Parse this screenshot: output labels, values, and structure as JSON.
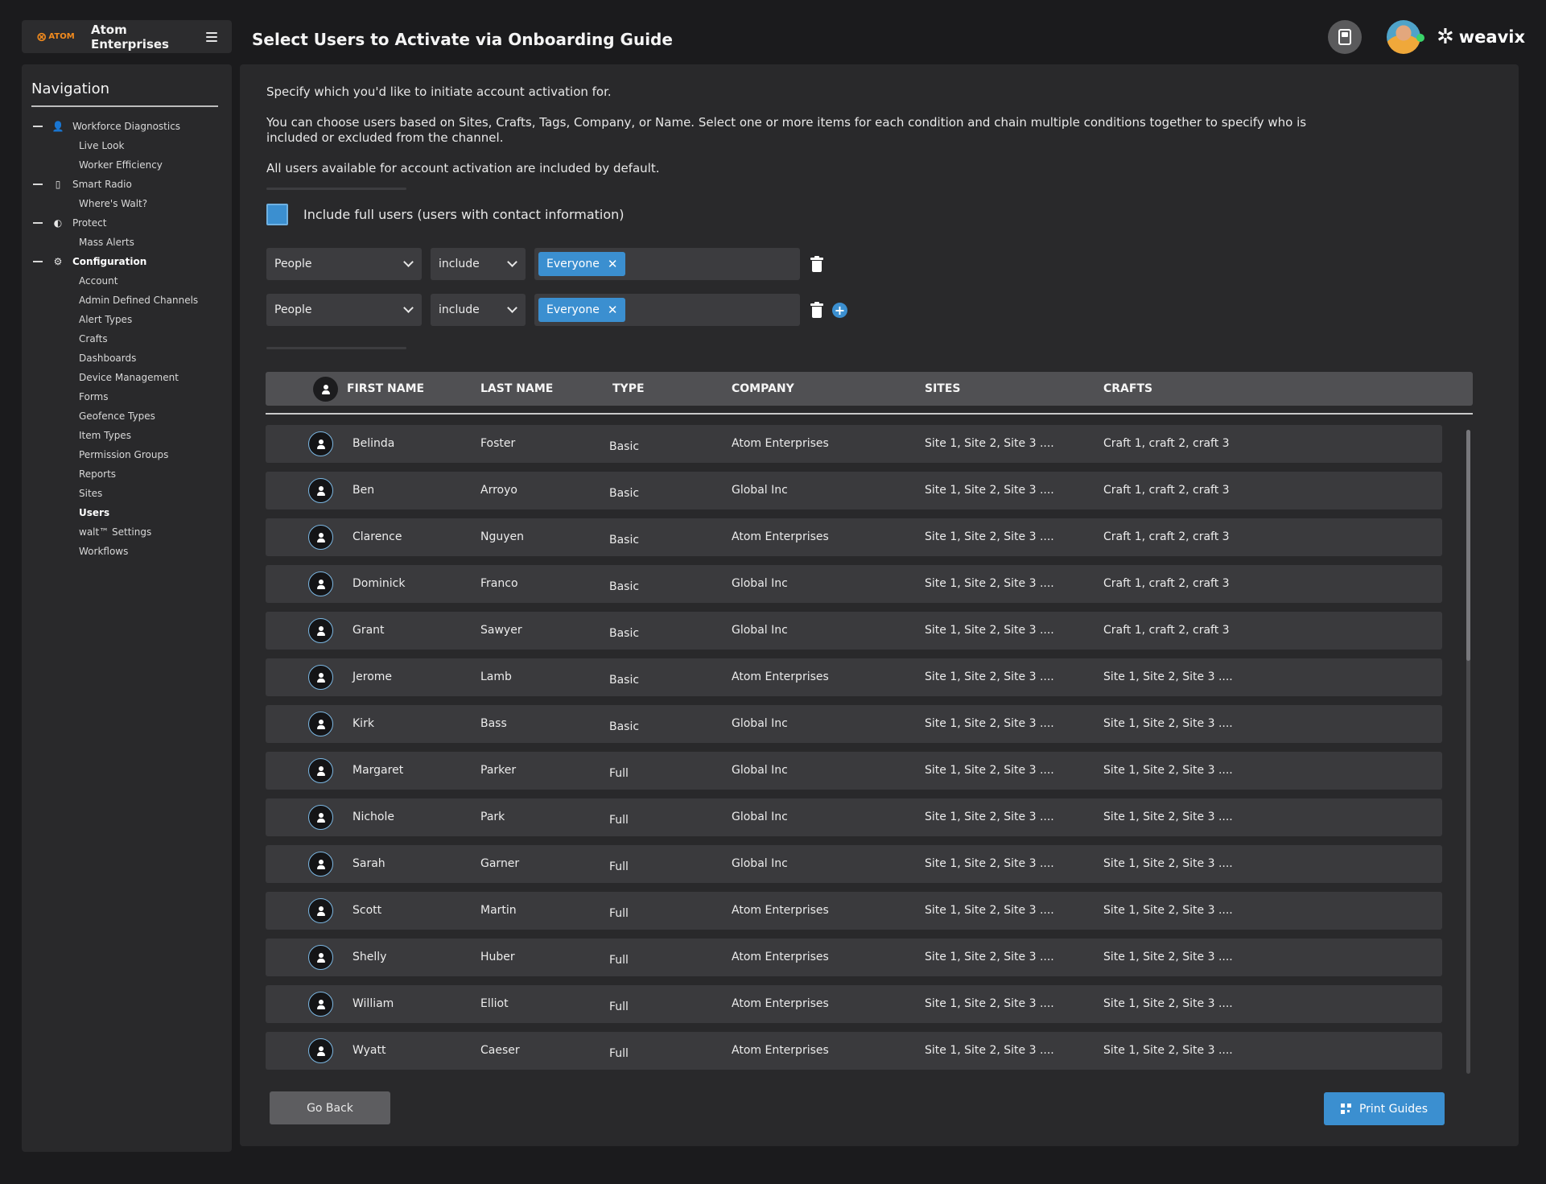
{
  "brand": {
    "logo_text": "ATOM",
    "name": "Atom Enterprises"
  },
  "page": {
    "title": "Select Users to Activate via Onboarding Guide"
  },
  "topbar": {
    "logo": "weavix",
    "icons": [
      "radio-device-icon",
      "user-avatar",
      "weavix-logo-icon"
    ],
    "presence_color": "#3ad46a"
  },
  "nav": {
    "title": "Navigation",
    "items": [
      {
        "label": "Workforce Diagnostics",
        "type": "parent",
        "icon": "person-icon"
      },
      {
        "label": "Live Look",
        "type": "child"
      },
      {
        "label": "Worker Efficiency",
        "type": "child"
      },
      {
        "label": "Smart Radio",
        "type": "parent",
        "icon": "radio-icon"
      },
      {
        "label": "Where's Walt?",
        "type": "child"
      },
      {
        "label": "Protect",
        "type": "parent",
        "icon": "shield-icon"
      },
      {
        "label": "Mass Alerts",
        "type": "child"
      },
      {
        "label": "Configuration",
        "type": "parent",
        "icon": "gear-icon",
        "expanded": true
      },
      {
        "label": "Account",
        "type": "child"
      },
      {
        "label": "Admin Defined Channels",
        "type": "child"
      },
      {
        "label": "Alert Types",
        "type": "child"
      },
      {
        "label": "Crafts",
        "type": "child"
      },
      {
        "label": "Dashboards",
        "type": "child"
      },
      {
        "label": "Device Management",
        "type": "child"
      },
      {
        "label": "Forms",
        "type": "child"
      },
      {
        "label": "Geofence Types",
        "type": "child"
      },
      {
        "label": "Item Types",
        "type": "child"
      },
      {
        "label": "Permission Groups",
        "type": "child"
      },
      {
        "label": "Reports",
        "type": "child"
      },
      {
        "label": "Sites",
        "type": "child"
      },
      {
        "label": "Users",
        "type": "child",
        "active": true
      },
      {
        "label": "walt™ Settings",
        "type": "child"
      },
      {
        "label": "Workflows",
        "type": "child"
      }
    ]
  },
  "intro": {
    "line1": "Specify which you'd like to initiate account activation for.",
    "line2": "You can choose users based on Sites, Crafts, Tags, Company, or Name. Select one or more items for each condition and chain multiple conditions together to specify who is included or excluded from the channel.",
    "line3": "All users available for account activation are included by default."
  },
  "include_full": {
    "label": "Include full users (users with contact information)",
    "checked": true
  },
  "conditions": [
    {
      "field": "People",
      "operator": "include",
      "tags": [
        "Everyone"
      ],
      "show_add": false
    },
    {
      "field": "People",
      "operator": "include",
      "tags": [
        "Everyone"
      ],
      "show_add": true
    }
  ],
  "table": {
    "columns": [
      "FIRST NAME",
      "LAST NAME",
      "TYPE",
      "COMPANY",
      "SITES",
      "CRAFTS"
    ],
    "rows": [
      {
        "first": "Belinda",
        "last": "Foster",
        "type": "Basic",
        "company": "Atom Enterprises",
        "sites": "Site 1, Site 2, Site 3 ....",
        "crafts": "Craft 1, craft 2, craft 3"
      },
      {
        "first": "Ben",
        "last": "Arroyo",
        "type": "Basic",
        "company": "Global Inc",
        "sites": "Site 1, Site 2, Site 3 ....",
        "crafts": "Craft 1, craft 2, craft 3"
      },
      {
        "first": "Clarence",
        "last": "Nguyen",
        "type": "Basic",
        "company": "Atom Enterprises",
        "sites": "Site 1, Site 2, Site 3 ....",
        "crafts": "Craft 1, craft 2, craft 3"
      },
      {
        "first": "Dominick",
        "last": "Franco",
        "type": "Basic",
        "company": "Global Inc",
        "sites": "Site 1, Site 2, Site 3 ....",
        "crafts": "Craft 1, craft 2, craft 3"
      },
      {
        "first": "Grant",
        "last": "Sawyer",
        "type": "Basic",
        "company": "Global Inc",
        "sites": "Site 1, Site 2, Site 3 ....",
        "crafts": "Craft 1, craft 2, craft 3"
      },
      {
        "first": "Jerome",
        "last": "Lamb",
        "type": "Basic",
        "company": "Atom Enterprises",
        "sites": "Site 1, Site 2, Site 3 ....",
        "crafts": "Site 1, Site 2, Site 3 ...."
      },
      {
        "first": "Kirk",
        "last": "Bass",
        "type": "Basic",
        "company": "Global Inc",
        "sites": "Site 1, Site 2, Site 3 ....",
        "crafts": "Site 1, Site 2, Site 3 ...."
      },
      {
        "first": "Margaret",
        "last": "Parker",
        "type": "Full",
        "company": "Global Inc",
        "sites": "Site 1, Site 2, Site 3 ....",
        "crafts": "Site 1, Site 2, Site 3 ...."
      },
      {
        "first": "Nichole",
        "last": "Park",
        "type": "Full",
        "company": "Global Inc",
        "sites": "Site 1, Site 2, Site 3 ....",
        "crafts": "Site 1, Site 2, Site 3 ...."
      },
      {
        "first": "Sarah",
        "last": "Garner",
        "type": "Full",
        "company": "Global Inc",
        "sites": "Site 1, Site 2, Site 3 ....",
        "crafts": "Site 1, Site 2, Site 3 ...."
      },
      {
        "first": "Scott",
        "last": "Martin",
        "type": "Full",
        "company": "Atom Enterprises",
        "sites": "Site 1, Site 2, Site 3 ....",
        "crafts": "Site 1, Site 2, Site 3 ...."
      },
      {
        "first": "Shelly",
        "last": "Huber",
        "type": "Full",
        "company": "Atom Enterprises",
        "sites": "Site 1, Site 2, Site 3 ....",
        "crafts": "Site 1, Site 2, Site 3 ...."
      },
      {
        "first": "William",
        "last": "Elliot",
        "type": "Full",
        "company": "Atom Enterprises",
        "sites": "Site 1, Site 2, Site 3 ....",
        "crafts": "Site 1, Site 2, Site 3 ...."
      },
      {
        "first": "Wyatt",
        "last": "Caeser",
        "type": "Full",
        "company": "Atom Enterprises",
        "sites": "Site 1, Site 2, Site 3 ....",
        "crafts": "Site 1, Site 2, Site 3 ...."
      }
    ]
  },
  "actions": {
    "back": "Go Back",
    "print": "Print Guides"
  },
  "colors": {
    "accent": "#3b8fd0",
    "background": "#1b1b1d",
    "panel": "#29292b",
    "brand_orange": "#f28b1e"
  }
}
